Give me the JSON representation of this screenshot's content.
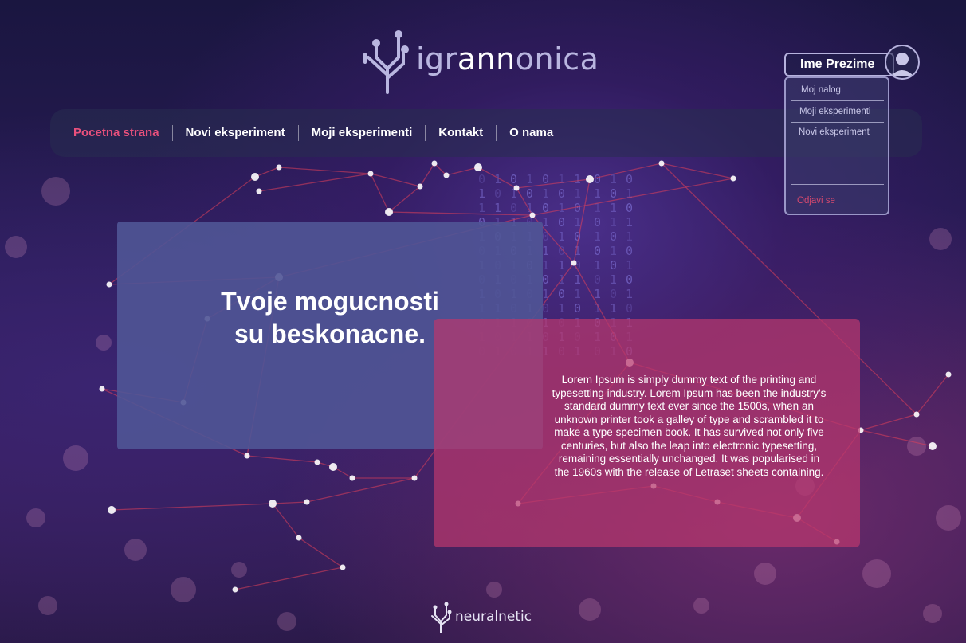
{
  "brand": {
    "name_light": "igr",
    "name_bold": "ann",
    "name_rest": "onica"
  },
  "nav": {
    "items": [
      {
        "label": "Pocetna strana",
        "active": true
      },
      {
        "label": "Novi eksperiment",
        "active": false
      },
      {
        "label": "Moji eksperimenti",
        "active": false
      },
      {
        "label": "Kontakt",
        "active": false
      },
      {
        "label": "O nama",
        "active": false
      }
    ]
  },
  "user": {
    "name": "Ime Prezime",
    "menu": [
      "Moj nalog",
      "Moji eksperimenti",
      "Novi eksperiment",
      "",
      ""
    ],
    "logout": "Odjavi se"
  },
  "hero": {
    "line1": "Tvoje mogucnosti",
    "line2": "su beskonacne."
  },
  "info": {
    "text": "Lorem Ipsum is simply dummy text of the printing and typesetting industry. Lorem Ipsum has been the industry's standard dummy text ever since the 1500s, when an unknown printer took a galley of type and scrambled it to make a type specimen book. It has survived not only five centuries, but also the leap into electronic typesetting, remaining essentially unchanged. It was popularised in the 1960s with the release of Letraset sheets containing."
  },
  "footer": {
    "brand": "neuralnetic"
  },
  "colors": {
    "accent": "#e8507c",
    "hero_card": "#5055a0",
    "info_card": "#b9376e",
    "logout": "#d4486e"
  }
}
